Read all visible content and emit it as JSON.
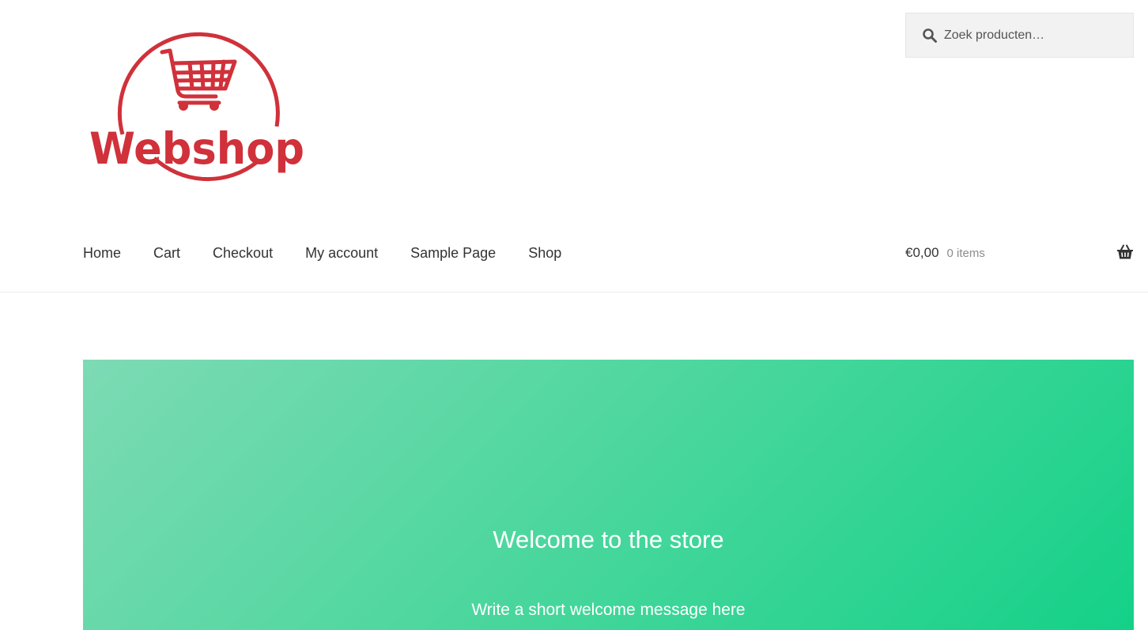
{
  "brand": {
    "logo_text": "Webshop",
    "logo_color": "#d0313a"
  },
  "search": {
    "placeholder": "Zoek producten…",
    "icon": "search-icon"
  },
  "nav": {
    "items": [
      {
        "label": "Home"
      },
      {
        "label": "Cart"
      },
      {
        "label": "Checkout"
      },
      {
        "label": "My account"
      },
      {
        "label": "Sample Page"
      },
      {
        "label": "Shop"
      }
    ]
  },
  "cart": {
    "amount": "€0,00",
    "count": "0 items",
    "icon": "basket-icon"
  },
  "hero": {
    "title": "Welcome to the store",
    "message": "Write a short welcome message here",
    "gradient_start": "#7ddab4",
    "gradient_end": "#14d188"
  }
}
